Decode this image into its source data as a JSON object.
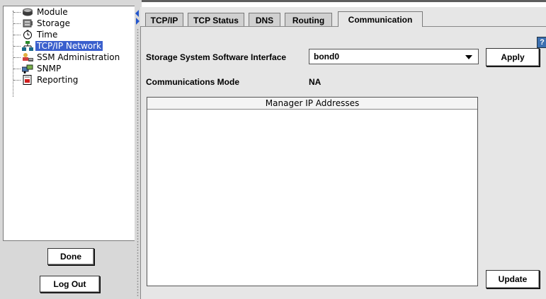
{
  "tree": {
    "items": [
      {
        "label": "Module",
        "icon": "module-icon",
        "selected": false
      },
      {
        "label": "Storage",
        "icon": "storage-icon",
        "selected": false
      },
      {
        "label": "Time",
        "icon": "clock-icon",
        "selected": false
      },
      {
        "label": "TCP/IP Network",
        "icon": "network-icon",
        "selected": true
      },
      {
        "label": "SSM Administration",
        "icon": "admin-icon",
        "selected": false
      },
      {
        "label": "SNMP",
        "icon": "snmp-icon",
        "selected": false
      },
      {
        "label": "Reporting",
        "icon": "report-icon",
        "selected": false
      }
    ]
  },
  "buttons": {
    "done": "Done",
    "logout": "Log Out",
    "apply": "Apply",
    "update": "Update"
  },
  "tabs": [
    {
      "label": "TCP/IP",
      "active": false
    },
    {
      "label": "TCP Status",
      "active": false
    },
    {
      "label": "DNS",
      "active": false
    },
    {
      "label": "Routing",
      "active": false
    },
    {
      "label": "Communication",
      "active": true
    }
  ],
  "help_label": "?",
  "form": {
    "interface_label": "Storage System Software Interface",
    "interface_value": "bond0",
    "mode_label": "Communications Mode",
    "mode_value": "NA"
  },
  "manager_table": {
    "header": "Manager IP Addresses",
    "rows": []
  },
  "colors": {
    "selection": "#3a5fcd",
    "panel_bg": "#e6e6e6",
    "sidebar_bg": "#d8d8d8"
  }
}
